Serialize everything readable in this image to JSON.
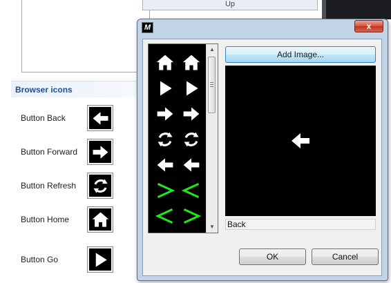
{
  "background": {
    "header_text": "Up"
  },
  "browser_icons": {
    "section_title": "Browser icons",
    "rows": [
      {
        "label": "Button Back",
        "icon": "arrow-left-icon"
      },
      {
        "label": "Button Forward",
        "icon": "arrow-right-icon"
      },
      {
        "label": "Button Refresh",
        "icon": "refresh-icon"
      },
      {
        "label": "Button Home",
        "icon": "home-icon"
      },
      {
        "label": "Button Go",
        "icon": "play-icon"
      }
    ]
  },
  "dialog": {
    "app_icon_text": "M",
    "close_label": "x",
    "add_image_label": "Add Image...",
    "selected_name": "Back",
    "ok_label": "OK",
    "cancel_label": "Cancel",
    "icon_list": [
      [
        "home-icon",
        "home-icon"
      ],
      [
        "play-icon",
        "play-icon"
      ],
      [
        "arrow-right-icon",
        "arrow-right-icon"
      ],
      [
        "refresh-icon",
        "refresh-icon"
      ],
      [
        "arrow-left-icon",
        "arrow-left-icon"
      ],
      [
        "green-chevron-right-icon",
        "green-chevron-left-icon"
      ],
      [
        "green-chevron-left-icon",
        "green-chevron-right-icon"
      ]
    ],
    "preview_icon": "arrow-left-icon",
    "colors": {
      "icon_white": "#ffffff",
      "icon_green": "#22e61a",
      "dialog_frame": "#c1d4e8",
      "section_title": "#1f4e94"
    }
  }
}
